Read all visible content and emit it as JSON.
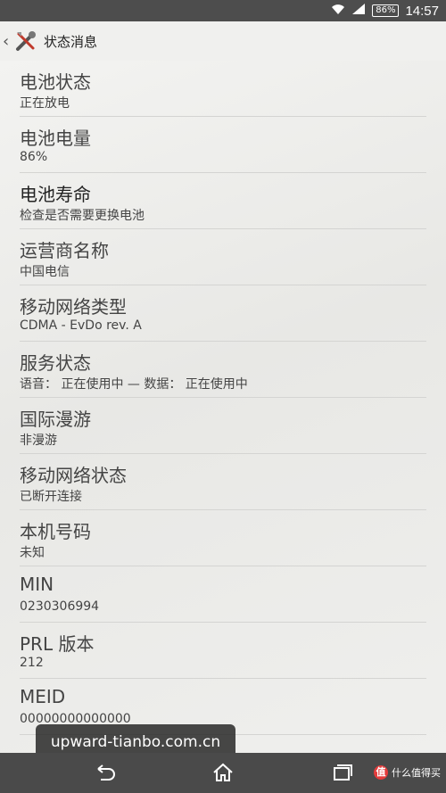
{
  "status_bar": {
    "battery": "86%",
    "time": "14:57"
  },
  "action_bar": {
    "title": "状态消息"
  },
  "items": [
    {
      "title": "电池状态",
      "value": "正在放电"
    },
    {
      "title": "电池电量",
      "value": "86%"
    },
    {
      "title": "电池寿命",
      "value": "检查是否需要更换电池"
    },
    {
      "title": "运营商名称",
      "value": "中国电信"
    },
    {
      "title": "移动网络类型",
      "value": "CDMA - EvDo rev. A"
    },
    {
      "title": "服务状态",
      "value": "语音： 正在使用中 — 数据： 正在使用中"
    },
    {
      "title": "国际漫游",
      "value": "非漫游"
    },
    {
      "title": "移动网络状态",
      "value": "已断开连接"
    },
    {
      "title": "本机号码",
      "value": "未知"
    },
    {
      "title": "MIN",
      "value": "0230306994"
    },
    {
      "title": "PRL 版本",
      "value": "212"
    },
    {
      "title": "MEID",
      "value": "00000000000000"
    }
  ],
  "watermark": "upward-tianbo.com.cn",
  "brand": "什么值得买"
}
